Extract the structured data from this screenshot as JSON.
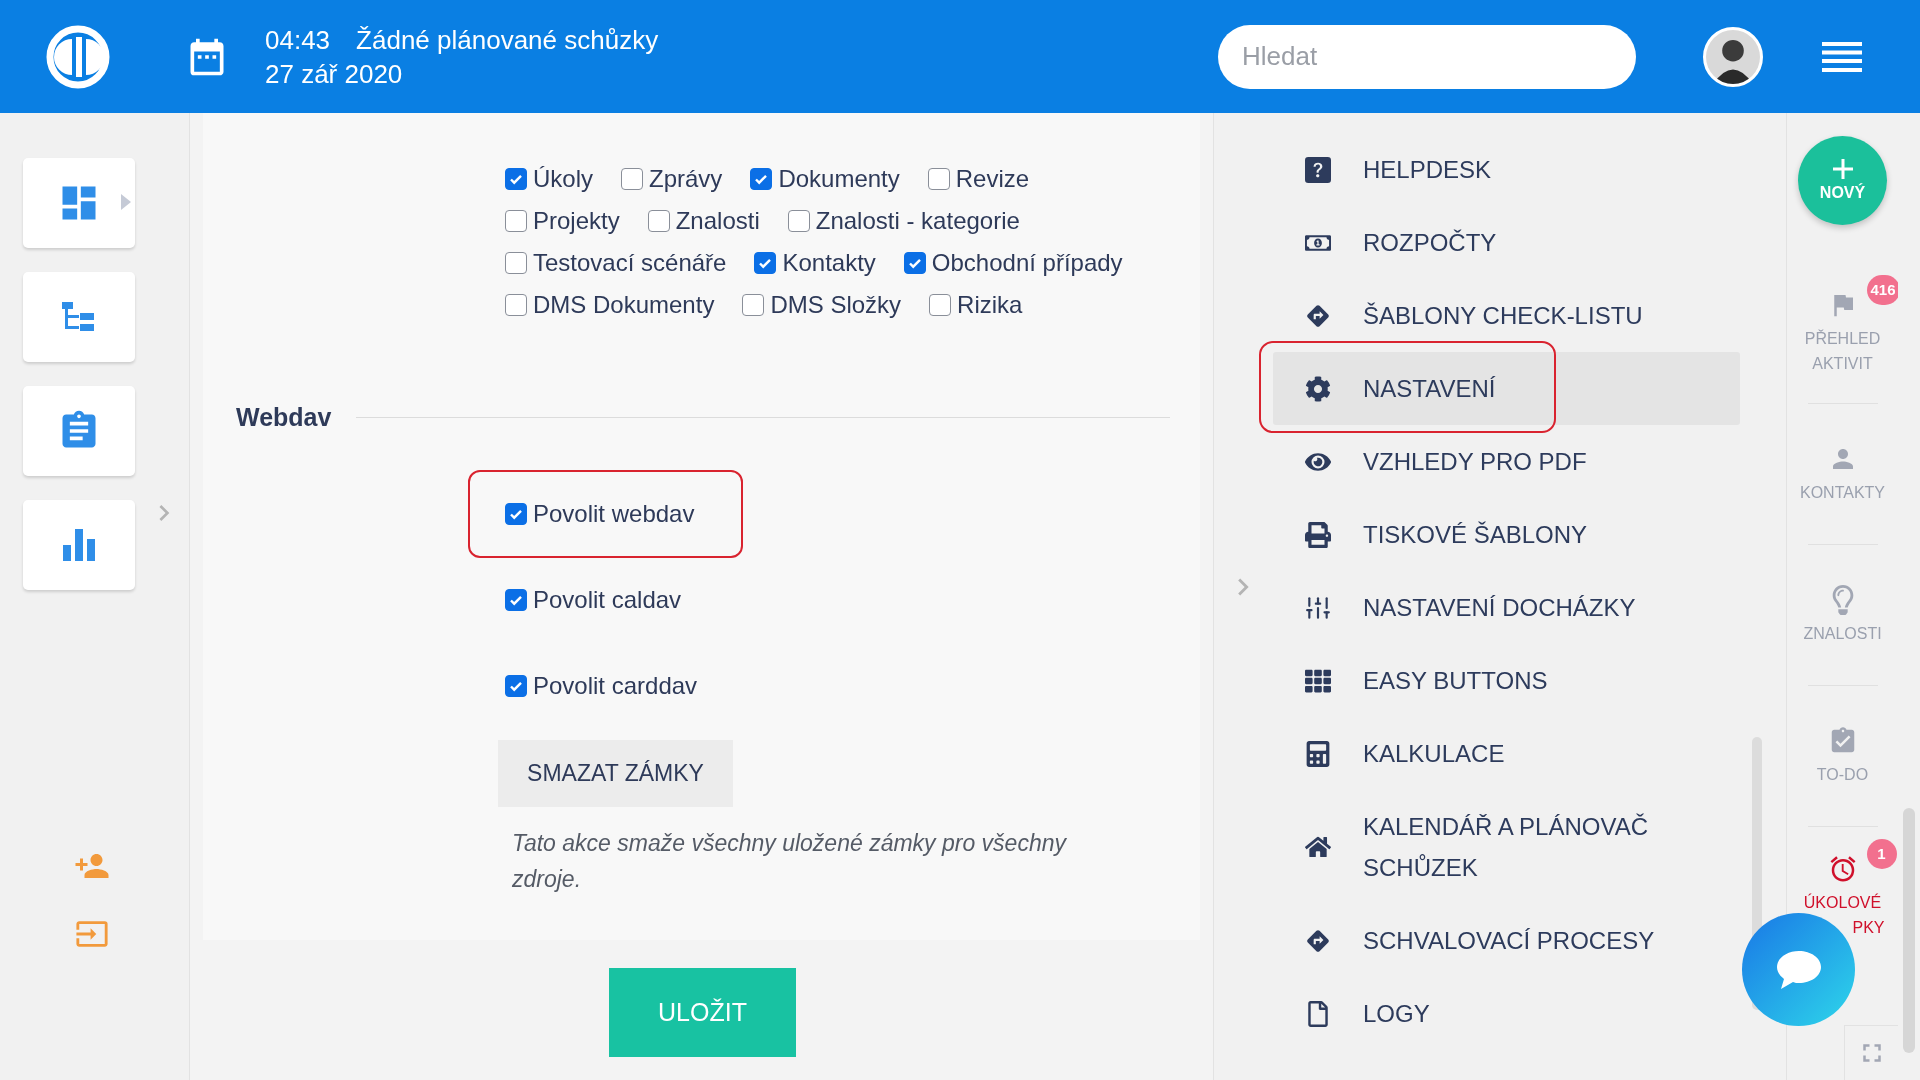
{
  "header": {
    "time": "04:43",
    "meetings": "Žádné plánované schůzky",
    "date": "27 zář 2020",
    "search": {
      "placeholder": "Hledat"
    }
  },
  "module_rows": [
    [
      {
        "label": "Úkoly",
        "checked": true
      },
      {
        "label": "Zprávy",
        "checked": false
      },
      {
        "label": "Dokumenty",
        "checked": true
      },
      {
        "label": "Revize",
        "checked": false
      }
    ],
    [
      {
        "label": "Projekty",
        "checked": false
      },
      {
        "label": "Znalosti",
        "checked": false
      },
      {
        "label": "Znalosti - kategorie",
        "checked": false
      }
    ],
    [
      {
        "label": "Testovací scénáře",
        "checked": false
      },
      {
        "label": "Kontakty",
        "checked": true
      },
      {
        "label": "Obchodní případy",
        "checked": true
      }
    ],
    [
      {
        "label": "DMS Dokumenty",
        "checked": false
      },
      {
        "label": "DMS Složky",
        "checked": false
      },
      {
        "label": "Rizika",
        "checked": false
      }
    ]
  ],
  "webdav": {
    "title": "Webdav",
    "options": [
      {
        "label": "Povolit webdav",
        "checked": true,
        "highlighted": true
      },
      {
        "label": "Povolit caldav",
        "checked": true,
        "highlighted": false
      },
      {
        "label": "Povolit carddav",
        "checked": true,
        "highlighted": false
      }
    ],
    "clear_button": "SMAZAT ZÁMKY",
    "note": "Tato akce smaže všechny uložené zámky pro všechny zdroje."
  },
  "save_button": "ULOŽIT",
  "menu": [
    {
      "kind": "help",
      "label": "HELPDESK",
      "selected": false,
      "highlighted": false
    },
    {
      "kind": "money",
      "label": "ROZPOČTY",
      "selected": false,
      "highlighted": false
    },
    {
      "kind": "directions",
      "label": "ŠABLONY CHECK-LISTU",
      "selected": false,
      "highlighted": false
    },
    {
      "kind": "gear",
      "label": "NASTAVENÍ",
      "selected": true,
      "highlighted": true
    },
    {
      "kind": "eye",
      "label": "VZHLEDY PRO PDF",
      "selected": false,
      "highlighted": false
    },
    {
      "kind": "printer",
      "label": "TISKOVÉ ŠABLONY",
      "selected": false,
      "highlighted": false
    },
    {
      "kind": "sliders",
      "label": "NASTAVENÍ DOCHÁZKY",
      "selected": false,
      "highlighted": false
    },
    {
      "kind": "grid",
      "label": "EASY BUTTONS",
      "selected": false,
      "highlighted": false
    },
    {
      "kind": "calculator",
      "label": "KALKULACE",
      "selected": false,
      "highlighted": false
    },
    {
      "kind": "home",
      "label": "KALENDÁŘ A PLÁNOVAČ SCHŮZEK",
      "selected": false,
      "highlighted": false
    },
    {
      "kind": "directions",
      "label": "SCHVALOVACÍ PROCESY",
      "selected": false,
      "highlighted": false
    },
    {
      "kind": "file",
      "label": "LOGY",
      "selected": false,
      "highlighted": false
    }
  ],
  "rail": {
    "new_button": "NOVÝ",
    "items": [
      {
        "kind": "flag",
        "lines": [
          "PŘEHLED",
          "AKTIVIT"
        ],
        "badge": "416",
        "active": false
      },
      {
        "kind": "person",
        "lines": [
          "KONTAKTY"
        ],
        "active": false
      },
      {
        "kind": "bulb",
        "lines": [
          "ZNALOSTI"
        ],
        "active": false
      },
      {
        "kind": "todo",
        "lines": [
          "TO-DO"
        ],
        "active": false
      },
      {
        "kind": "alarm",
        "lines": [
          "ÚKOLOVÉ",
          "PKY"
        ],
        "badge": "1",
        "active": true
      }
    ]
  }
}
